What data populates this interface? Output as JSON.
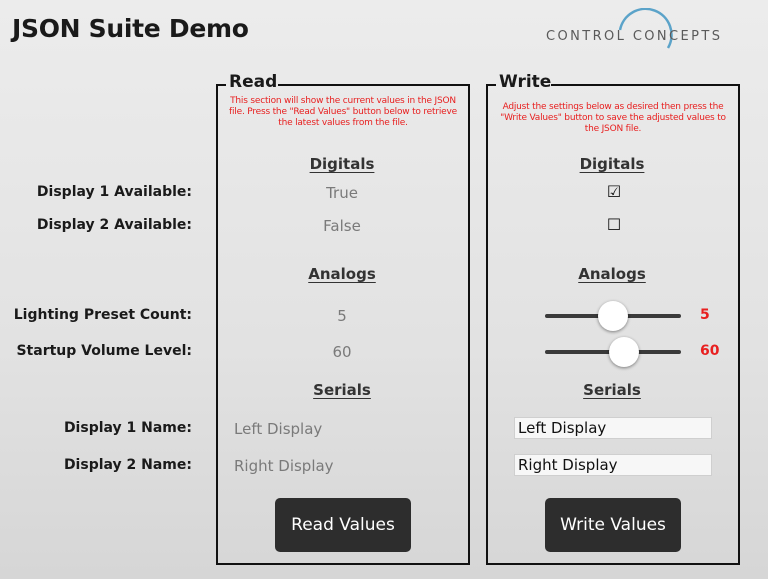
{
  "app_title": "JSON Suite Demo",
  "logo": {
    "text": "CONTROL CONCEPTS",
    "icon": "arc-icon",
    "color": "#5ba3c9"
  },
  "colors": {
    "accent_red": "#e82020",
    "button_bg": "#2d2d2d"
  },
  "labels": {
    "display1_available": "Display 1 Available:",
    "display2_available": "Display 2 Available:",
    "lighting_preset_count": "Lighting Preset Count:",
    "startup_volume_level": "Startup Volume Level:",
    "display1_name": "Display 1 Name:",
    "display2_name": "Display 2 Name:"
  },
  "read": {
    "title": "Read",
    "note": "This section will show the current values in the JSON file. Press the \"Read Values\" button below to retrieve the latest values from the file.",
    "digitals_header": "Digitals",
    "analogs_header": "Analogs",
    "serials_header": "Serials",
    "display1_available": "True",
    "display2_available": "False",
    "lighting_preset_count": "5",
    "startup_volume_level": "60",
    "display1_name": "Left Display",
    "display2_name": "Right Display",
    "button_label": "Read Values"
  },
  "write": {
    "title": "Write",
    "note": "Adjust the settings below as desired then press the \"Write Values\" button to save the adjusted values to the JSON file.",
    "digitals_header": "Digitals",
    "analogs_header": "Analogs",
    "serials_header": "Serials",
    "display1_available_checked": "☑",
    "display2_available_checked": "☐",
    "lighting_preset_count": "5",
    "startup_volume_level": "60",
    "lighting_slider_fraction": 0.5,
    "volume_slider_fraction": 0.58,
    "display1_name": "Left Display",
    "display2_name": "Right Display",
    "button_label": "Write Values"
  }
}
